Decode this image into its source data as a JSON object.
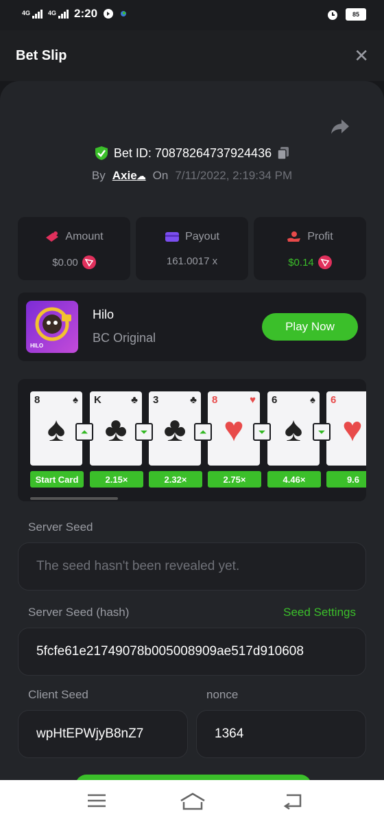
{
  "status_bar": {
    "net1": "4G",
    "net2": "4G",
    "time": "2:20",
    "battery": "85"
  },
  "header": {
    "title": "Bet Slip",
    "close_icon": "close-icon"
  },
  "bet": {
    "id_label": "Bet ID: 70878264737924436",
    "by_label": "By",
    "user": "Axie",
    "on_label": "On",
    "date": "7/11/2022, 2:19:34 PM"
  },
  "stats": {
    "amount": {
      "label": "Amount",
      "value": "$0.00"
    },
    "payout": {
      "label": "Payout",
      "value": "161.0017 x"
    },
    "profit": {
      "label": "Profit",
      "value": "$0.14"
    }
  },
  "game": {
    "name": "Hilo",
    "subtitle": "BC Original",
    "play_label": "Play Now",
    "thumb_text": "HILO"
  },
  "cards": [
    {
      "rank": "8",
      "suit": "♠",
      "color": "black"
    },
    {
      "rank": "K",
      "suit": "♣",
      "color": "black"
    },
    {
      "rank": "3",
      "suit": "♣",
      "color": "black"
    },
    {
      "rank": "8",
      "suit": "♥",
      "color": "red"
    },
    {
      "rank": "6",
      "suit": "♠",
      "color": "black"
    },
    {
      "rank": "6",
      "suit": "♥",
      "color": "red"
    }
  ],
  "arrows": [
    "up",
    "down",
    "up",
    "down",
    "down"
  ],
  "multipliers": [
    "Start Card",
    "2.15×",
    "2.32×",
    "2.75×",
    "4.46×",
    "9.6"
  ],
  "seeds": {
    "server_seed_label": "Server Seed",
    "server_seed_value": "The seed hasn't been revealed yet.",
    "server_hash_label": "Server Seed (hash)",
    "seed_settings": "Seed Settings",
    "server_hash_value": "5fcfe61e21749078b005008909ae517d910608",
    "client_seed_label": "Client Seed",
    "client_seed_value": "wpHtEPWjyB8nZ7",
    "nonce_label": "nonce",
    "nonce_value": "1364"
  },
  "colors": {
    "accent": "#3bbf2a",
    "background": "#17181b",
    "card_bg": "#1a1b1f",
    "coin": "#e0305c"
  }
}
